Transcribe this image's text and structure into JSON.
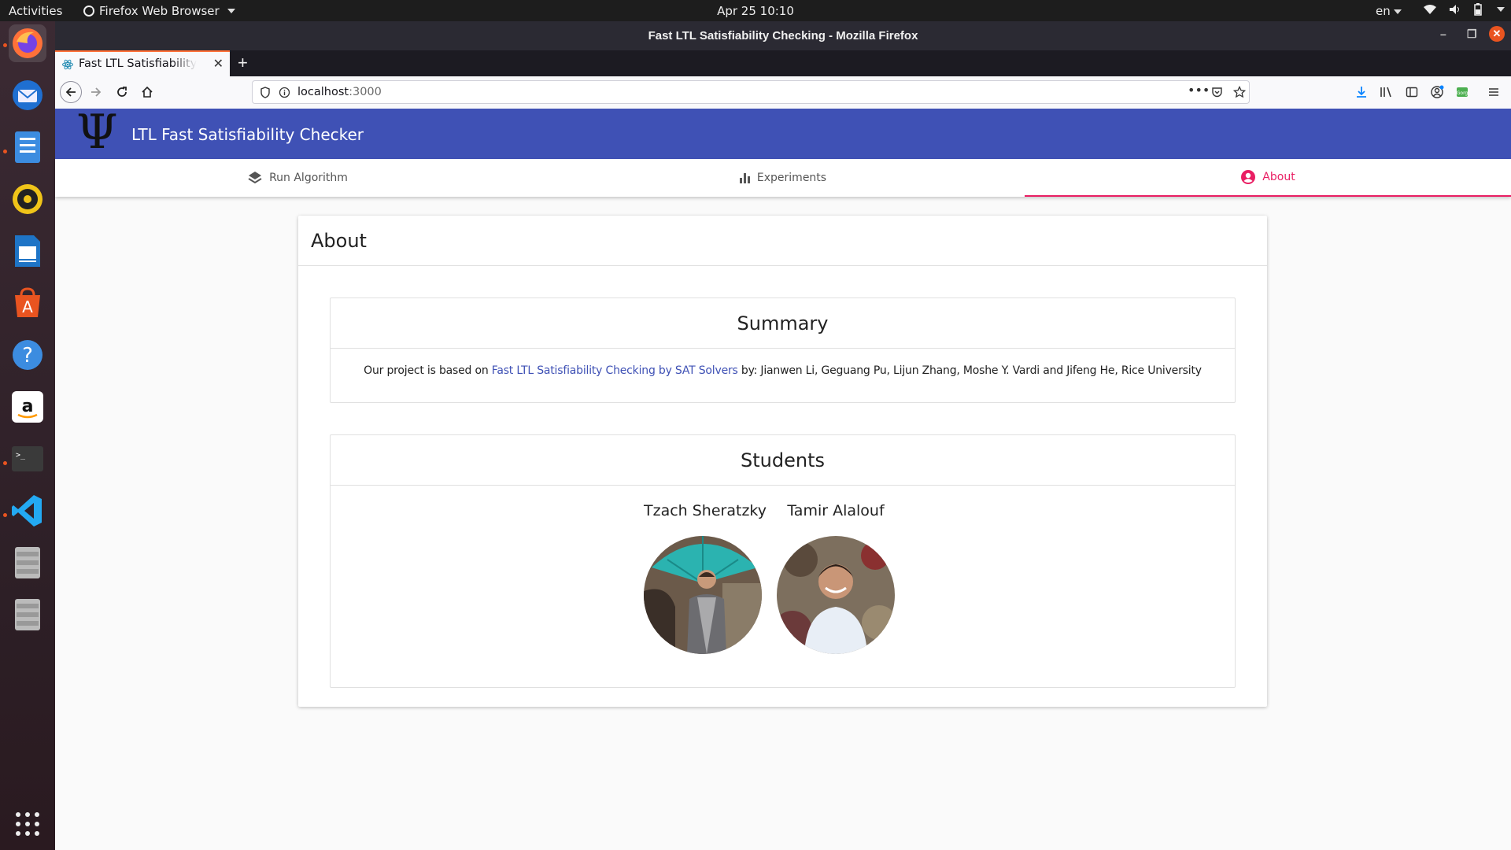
{
  "system_bar": {
    "activities": "Activities",
    "app_menu": "Firefox Web Browser",
    "clock": "Apr 25  10:10",
    "language": "en"
  },
  "window": {
    "title": "Fast LTL Satisfiability Checking - Mozilla Firefox"
  },
  "browser": {
    "tab_title": "Fast LTL Satisfiability Checking",
    "url_host": "localhost",
    "url_port": ":3000"
  },
  "app": {
    "logo": "Ψ",
    "title": "LTL Fast Satisfiability Checker",
    "tabs": [
      {
        "label": "Run Algorithm",
        "icon": "layers-icon"
      },
      {
        "label": "Experiments",
        "icon": "bar-chart-icon"
      },
      {
        "label": "About",
        "icon": "account-circle-icon",
        "active": true
      }
    ],
    "accent": "#e91e63",
    "primary": "#3f51b5"
  },
  "about": {
    "title": "About",
    "summary": {
      "heading": "Summary",
      "text_before": "Our project is based on ",
      "link_text": "Fast LTL Satisfiability Checking by SAT Solvers",
      "text_after": " by: Jianwen Li, Geguang Pu, Lijun Zhang, Moshe Y. Vardi and Jifeng He, Rice University"
    },
    "students": {
      "heading": "Students",
      "people": [
        {
          "name": "Tzach Sheratzky"
        },
        {
          "name": "Tamir Alalouf"
        }
      ]
    }
  }
}
